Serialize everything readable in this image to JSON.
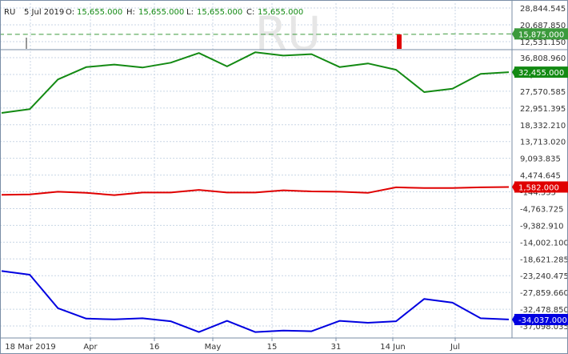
{
  "header": {
    "symbol": "RU",
    "date": "5 Jul 2019",
    "o_label": "O:",
    "o_value": "15,655.000",
    "h_label": "H:",
    "h_value": "15,655.000",
    "l_label": "L:",
    "l_value": "15,655.000",
    "c_label": "C:",
    "c_value": "15,655.000"
  },
  "watermark": "RU",
  "colors": {
    "background": "#ffffff",
    "grid": "#c8d6e5",
    "frame": "#7a8ea6",
    "price": "#3c9a3c",
    "green": "#138a13",
    "red": "#e00000",
    "blue": "#0000e0"
  },
  "chart_data": {
    "type": "line",
    "x_tick_labels": [
      "18 Mar 2019",
      "Apr",
      "16",
      "May",
      "15",
      "31",
      "14 Jun",
      "Jul"
    ],
    "top_panel": {
      "y_tick_labels": [
        "28,844.545",
        "20,687.850",
        "12,531.150"
      ],
      "ylim": [
        8500,
        31000
      ],
      "series": [
        {
          "color": "#3c9a3c",
          "last_value_label": "15,875.000",
          "values": [
            15655,
            15655,
            15655,
            15655,
            15655,
            15655,
            15655,
            15655,
            15655,
            15655,
            15655,
            15655,
            15655,
            15655,
            15655,
            15655,
            15655,
            15655,
            15655,
            15655,
            15655,
            15655,
            15655,
            15655,
            15655,
            15655,
            15655,
            15655,
            15655,
            15655,
            15655,
            15655,
            15655,
            15655,
            15655,
            15655,
            15655,
            15655,
            15655,
            15655,
            15655,
            15655,
            15655,
            15655,
            15655,
            15655,
            15655,
            15655,
            15655,
            15655,
            15655,
            15655,
            15655,
            15655,
            15655,
            15655,
            15875,
            15875,
            15875,
            15875,
            15875,
            15875,
            15875,
            15875,
            15875
          ]
        }
      ]
    },
    "bottom_panel": {
      "y_tick_labels": [
        "36,808.960",
        "32,189.770",
        "27,570.585",
        "22,951.395",
        "18,332.210",
        "13,713.020",
        "9,093.835",
        "4,474.645",
        "-144.535",
        "-4,763.725",
        "-9,382.910",
        "-14,002.100",
        "-18,621.285",
        "-23,240.475",
        "-27,859.660",
        "-32,478.850",
        "-37,098.035"
      ],
      "ylim": [
        -39000,
        38500
      ],
      "series": [
        {
          "color": "#138a13",
          "last_value_label": "32,455.000",
          "values": [
            21500,
            22500,
            30500,
            33800,
            34500,
            33700,
            35000,
            37600,
            34000,
            37800,
            36900,
            37300,
            33800,
            34800,
            33100,
            27100,
            28000,
            32000,
            32455
          ]
        },
        {
          "color": "#e00000",
          "last_value_label": "1,582.000",
          "values": [
            -500,
            -400,
            300,
            0,
            -600,
            100,
            100,
            800,
            100,
            100,
            700,
            400,
            300,
            0,
            1500,
            1300,
            1300,
            1500,
            1582
          ]
        },
        {
          "color": "#0000e0",
          "last_value_label": "-34,037.000",
          "values": [
            -21000,
            -22000,
            -31000,
            -33800,
            -34000,
            -33700,
            -34500,
            -37400,
            -34400,
            -37400,
            -37000,
            -37200,
            -34400,
            -34900,
            -34500,
            -28500,
            -29500,
            -33700,
            -34037
          ]
        }
      ]
    },
    "grid": true
  }
}
